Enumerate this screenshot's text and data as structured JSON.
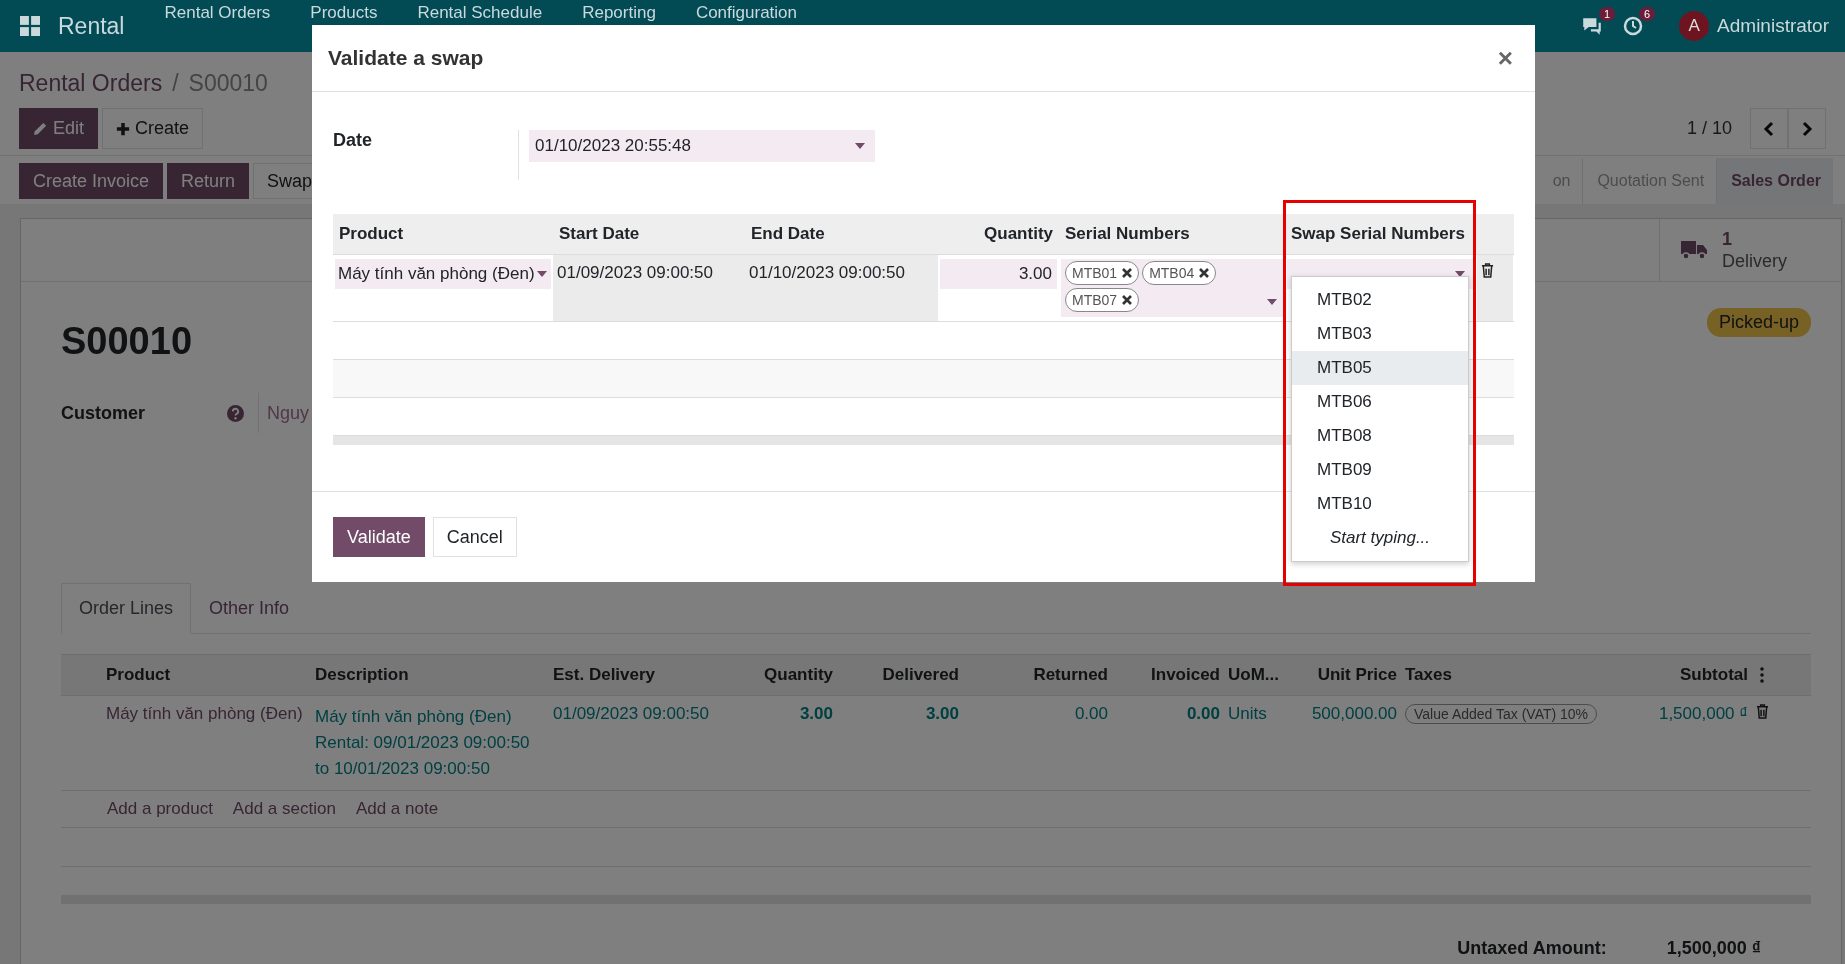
{
  "navbar": {
    "app": "Rental",
    "menu": [
      "Rental Orders",
      "Products",
      "Rental Schedule",
      "Reporting",
      "Configuration"
    ],
    "messages_count": "1",
    "activities_count": "6",
    "user_initial": "A",
    "user_name": "Administrator"
  },
  "breadcrumb": {
    "parent": "Rental Orders",
    "separator": "/",
    "current": "S00010"
  },
  "edit_button": "Edit",
  "create_button": "Create",
  "pager": "1 / 10",
  "header_buttons": [
    {
      "label": "Create Invoice",
      "kind": "primary"
    },
    {
      "label": "Return",
      "kind": "primary"
    },
    {
      "label": "Swap",
      "kind": "secondary"
    }
  ],
  "statusbar": [
    {
      "label": "on",
      "selected": false
    },
    {
      "label": "Quotation Sent",
      "selected": false
    },
    {
      "label": "Sales Order",
      "selected": true
    }
  ],
  "smart_button": {
    "count": "1",
    "label": "Delivery"
  },
  "record": {
    "name": "S00010",
    "status_badge": "Picked-up",
    "customer_label": "Customer",
    "customer_value": "Nguy"
  },
  "tabs": [
    {
      "label": "Order Lines",
      "selected": true
    },
    {
      "label": "Other Info",
      "selected": false
    }
  ],
  "order_lines": {
    "columns": [
      "Product",
      "Description",
      "Est. Delivery",
      "Quantity",
      "Delivered",
      "Returned",
      "Invoiced",
      "UoM...",
      "Unit Price",
      "Taxes",
      "Subtotal"
    ],
    "rows": [
      {
        "product": "Máy tính văn phòng (Đen)",
        "description": [
          "Máy tính văn phòng (Đen)",
          "Rental: 09/01/2023 09:00:50",
          "to 10/01/2023 09:00:50"
        ],
        "est_delivery": "01/09/2023 09:00:50",
        "quantity": "3.00",
        "delivered": "3.00",
        "returned": "0.00",
        "invoiced": "0.00",
        "uom": "Units",
        "unit_price": "500,000.00",
        "tax": "Value Added Tax (VAT) 10%",
        "subtotal": "1,500,000 ₫"
      }
    ],
    "add_links": [
      "Add a product",
      "Add a section",
      "Add a note"
    ]
  },
  "totals": [
    {
      "label": "Untaxed Amount:",
      "value": "1,500,000 ₫"
    }
  ],
  "dialog": {
    "title": "Validate a swap",
    "close": "×",
    "date_label": "Date",
    "date_value": "01/10/2023 20:55:48",
    "columns": [
      "Product",
      "Start Date",
      "End Date",
      "Quantity",
      "Serial Numbers",
      "Swap Serial Numbers"
    ],
    "line": {
      "product": "Máy tính văn phòng (Đen)",
      "start_date": "01/09/2023 09:00:50",
      "end_date": "01/10/2023 09:00:50",
      "quantity": "3.00",
      "serial_numbers": [
        "MTB01",
        "MTB04",
        "MTB07"
      ]
    },
    "swap_options": [
      {
        "label": "MTB02",
        "selected": false
      },
      {
        "label": "MTB03",
        "selected": false
      },
      {
        "label": "MTB05",
        "selected": true
      },
      {
        "label": "MTB06",
        "selected": false
      },
      {
        "label": "MTB08",
        "selected": false
      },
      {
        "label": "MTB09",
        "selected": false
      },
      {
        "label": "MTB10",
        "selected": false
      }
    ],
    "swap_hint": "Start typing...",
    "buttons": [
      {
        "label": "Validate",
        "kind": "primary"
      },
      {
        "label": "Cancel",
        "kind": "secondary"
      }
    ]
  }
}
